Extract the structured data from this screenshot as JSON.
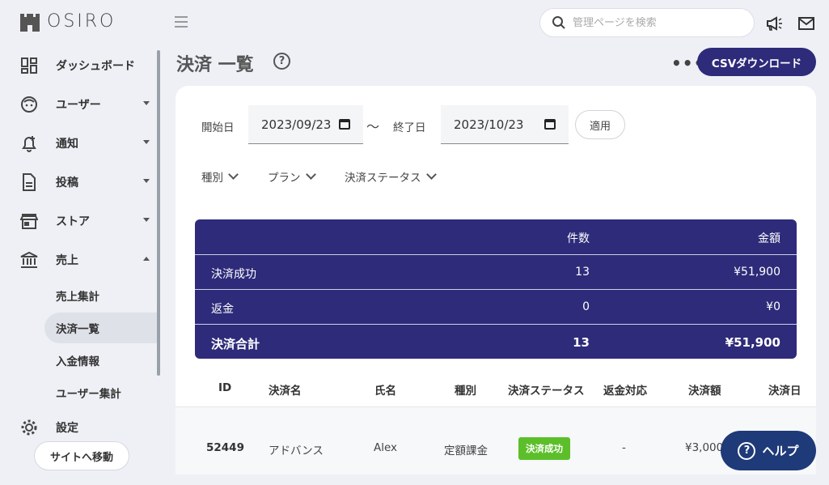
{
  "header": {
    "logo_text": "OSIRO",
    "search_placeholder": "管理ページを検索"
  },
  "sidebar": {
    "items": [
      {
        "label": "ダッシュボード",
        "icon": "dashboard-icon"
      },
      {
        "label": "ユーザー",
        "icon": "user-icon"
      },
      {
        "label": "通知",
        "icon": "bell-icon"
      },
      {
        "label": "投稿",
        "icon": "document-icon"
      },
      {
        "label": "ストア",
        "icon": "store-icon"
      },
      {
        "label": "売上",
        "icon": "bank-icon"
      }
    ],
    "sub_items": [
      "売上集計",
      "決済一覧",
      "入金情報",
      "ユーザー集計"
    ],
    "partial_item": "設定",
    "site_button": "サイトへ移動"
  },
  "page": {
    "title": "決済 一覧",
    "csv_button": "CSVダウンロード"
  },
  "filters": {
    "start_label": "開始日",
    "start_value": "2023/09/23",
    "tilde": "〜",
    "end_label": "終了日",
    "end_value": "2023/10/23",
    "apply_button": "適用",
    "dropdowns": [
      "種別",
      "プラン",
      "決済ステータス"
    ]
  },
  "summary": {
    "headers": [
      "",
      "件数",
      "金額"
    ],
    "rows": [
      {
        "label": "決済成功",
        "count": "13",
        "amount": "¥51,900"
      },
      {
        "label": "返金",
        "count": "0",
        "amount": "¥0"
      },
      {
        "label": "決済合計",
        "count": "13",
        "amount": "¥51,900"
      }
    ]
  },
  "table": {
    "columns": [
      "ID",
      "決済名",
      "氏名",
      "種別",
      "決済ステータス",
      "返金対応",
      "決済額",
      "決済日"
    ],
    "rows": [
      {
        "id": "52449",
        "name": "アドバンス",
        "user": "Alex",
        "type": "定額課金",
        "status": "決済成功",
        "refund": "-",
        "amount": "¥3,000"
      }
    ]
  },
  "help_button": "ヘルプ",
  "colors": {
    "primary": "#2e2b7a",
    "success": "#5cbf2a",
    "help": "#1f3a78"
  }
}
